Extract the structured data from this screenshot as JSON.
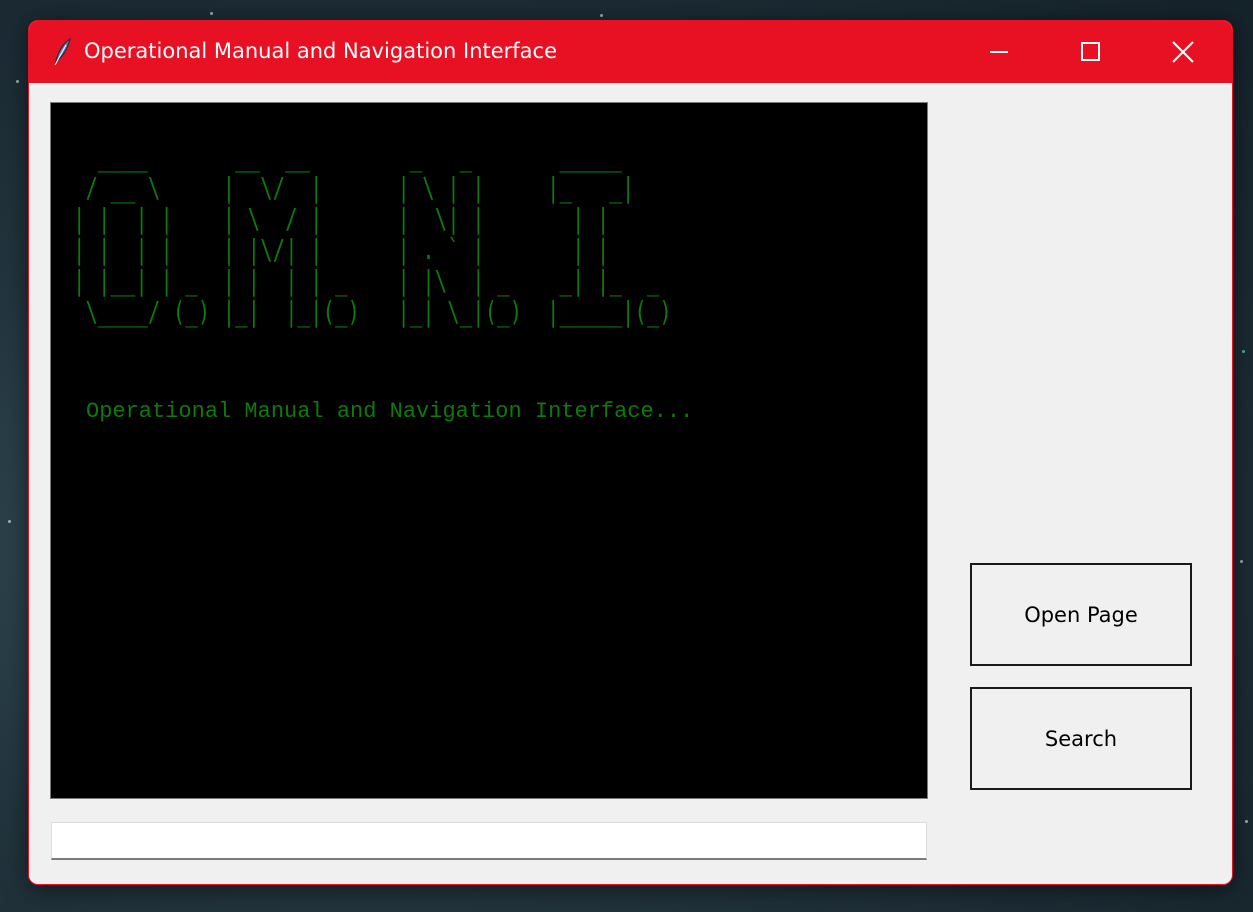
{
  "window": {
    "title": "Operational Manual and Navigation Interface",
    "icons": {
      "app": "feather-icon",
      "minimize": "minimize-icon",
      "maximize": "maximize-icon",
      "close": "close-icon"
    }
  },
  "terminal": {
    "ascii_art": "  ____       __  __        _   _       _____        \n / __ \\     |  \\/  |      | \\ | |     |_   _|       \n| |  | |    | \\  / |      |  \\| |       | |         \n| |  | |    | |\\/| |      | . ` |       | |         \n| |__| | _  | |  | | _    | |\\  | _    _| |_  _     \n \\____/ (_) |_|  |_|(_)   |_| \\_|(_)  |_____|(_)    ",
    "tagline": "Operational Manual and Navigation Interface...",
    "text_color": "#0c7a0c",
    "background": "#000000"
  },
  "command_input": {
    "value": "",
    "placeholder": ""
  },
  "buttons": {
    "open_page": "Open Page",
    "search": "Search"
  },
  "colors": {
    "titlebar": "#e81123",
    "window_bg": "#f0f0f0"
  }
}
